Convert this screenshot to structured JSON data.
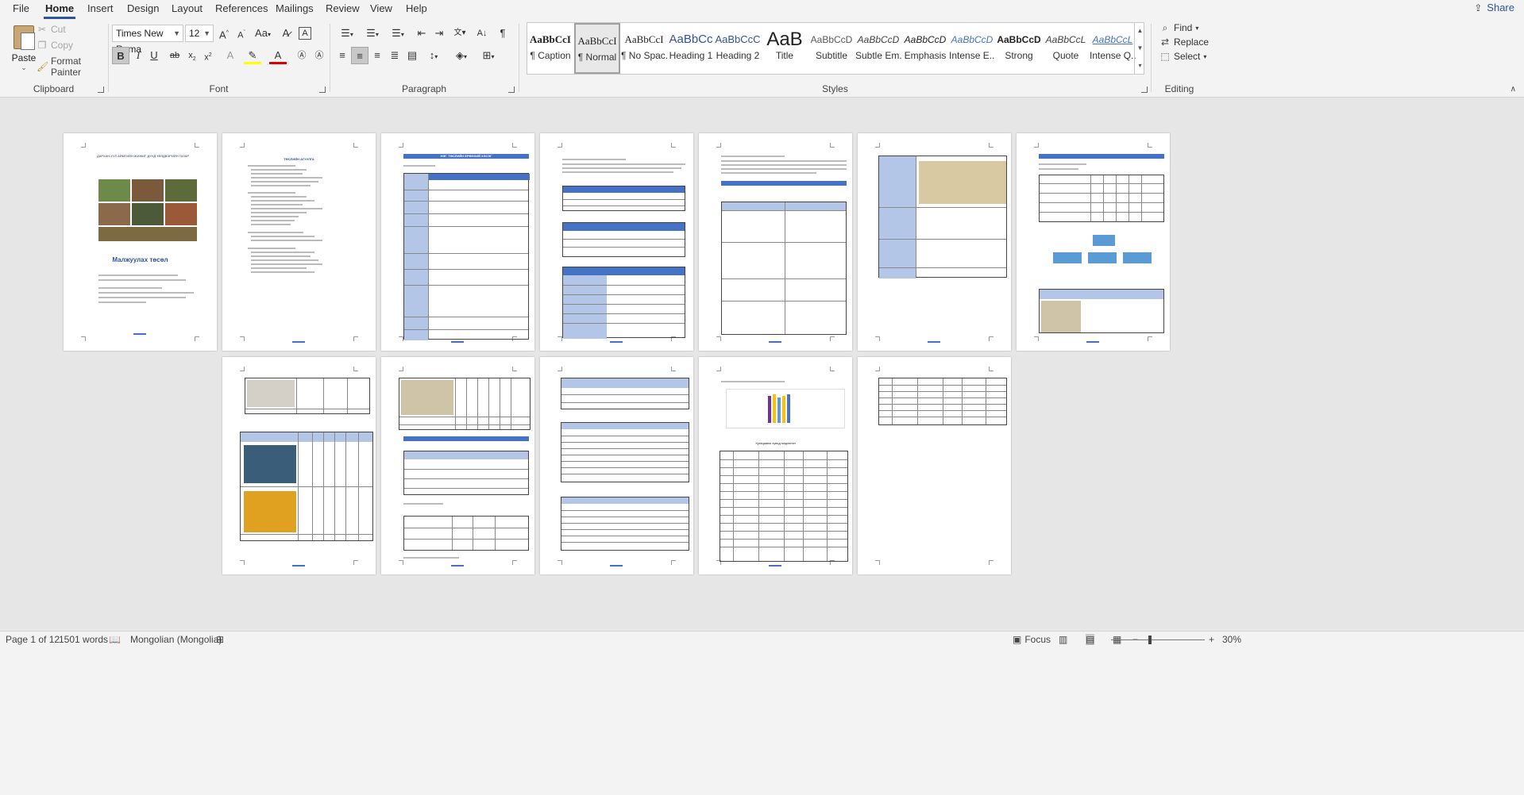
{
  "tabs": [
    "File",
    "Home",
    "Insert",
    "Design",
    "Layout",
    "References",
    "Mailings",
    "Review",
    "View",
    "Help"
  ],
  "active_tab": "Home",
  "share_label": "Share",
  "clipboard": {
    "paste_label": "Paste",
    "cut_label": "Cut",
    "copy_label": "Copy",
    "format_painter_label": "Format Painter",
    "group_label": "Clipboard"
  },
  "font": {
    "family": "Times New Roma",
    "size": "12",
    "group_label": "Font"
  },
  "paragraph": {
    "group_label": "Paragraph"
  },
  "styles": {
    "group_label": "Styles",
    "items": [
      {
        "sample": "AaBbCcI",
        "name": "¶ Caption",
        "selected": false
      },
      {
        "sample": "AaBbCcI",
        "name": "¶ Normal",
        "selected": true
      },
      {
        "sample": "AaBbCcI",
        "name": "¶ No Spac...",
        "selected": false
      },
      {
        "sample": "AaBbCc",
        "name": "Heading 1",
        "selected": false
      },
      {
        "sample": "AaBbCcC",
        "name": "Heading 2",
        "selected": false
      },
      {
        "sample": "AaB",
        "name": "Title",
        "selected": false
      },
      {
        "sample": "AaBbCcD",
        "name": "Subtitle",
        "selected": false
      },
      {
        "sample": "AaBbCcD",
        "name": "Subtle Em...",
        "selected": false
      },
      {
        "sample": "AaBbCcD",
        "name": "Emphasis",
        "selected": false
      },
      {
        "sample": "AaBbCcD",
        "name": "Intense E...",
        "selected": false
      },
      {
        "sample": "AaBbCcD",
        "name": "Strong",
        "selected": false
      },
      {
        "sample": "AaBbCcL",
        "name": "Quote",
        "selected": false
      },
      {
        "sample": "AaBbCcL",
        "name": "Intense Q...",
        "selected": false
      }
    ]
  },
  "editing": {
    "find_label": "Find",
    "replace_label": "Replace",
    "select_label": "Select",
    "group_label": "Editing"
  },
  "document": {
    "cover": {
      "org": "ДАРХАН-УУЛ АЙМГИЙН ЖИЖИГ ДУНД ҮЙЛДВЭРИЙН ГАЗАР",
      "title": "Малжуулах төсөл"
    },
    "toc_heading": "ТӨСЛИЙН АГУУЛГА",
    "section_heading": "НЭГ. ТӨСЛИЙН ЕРӨНХИЙ ХЭСЭГ",
    "chart_caption": "Хугацааны хувьд мэдээлэл"
  },
  "status": {
    "page": "Page 1 of 12",
    "words": "1501 words",
    "language": "Mongolian (Mongolia)",
    "focus_label": "Focus",
    "zoom": "30%"
  }
}
